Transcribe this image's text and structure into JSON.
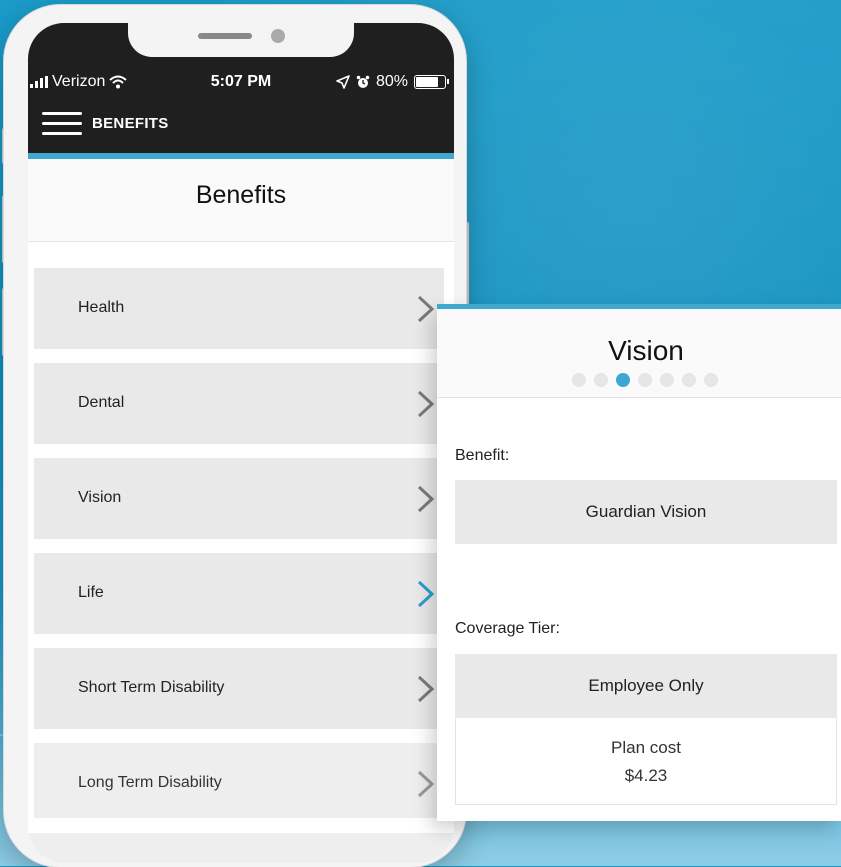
{
  "status_bar": {
    "carrier": "Verizon",
    "time": "5:07 PM",
    "battery": "80%",
    "battery_level": 0.8,
    "icons": [
      "signal-icon",
      "wifi-icon",
      "location-arrow-icon",
      "alarm-icon",
      "battery-icon"
    ]
  },
  "nav": {
    "menu_icon": "hamburger-menu-icon",
    "title": "BENEFITS"
  },
  "page": {
    "title": "Benefits"
  },
  "benefits_list": {
    "items": [
      {
        "label": "Health",
        "chevron_color": "#7a7a7a"
      },
      {
        "label": "Dental",
        "chevron_color": "#7a7a7a"
      },
      {
        "label": "Vision",
        "chevron_color": "#7a7a7a"
      },
      {
        "label": "Life",
        "chevron_color": "#2d9dc9"
      },
      {
        "label": "Short Term Disability",
        "chevron_color": "#7a7a7a"
      },
      {
        "label": "Long Term Disability",
        "chevron_color": "#9a9a9a"
      }
    ]
  },
  "vision_card": {
    "title": "Vision",
    "pager": {
      "total": 7,
      "active_index": 2
    },
    "benefit_label": "Benefit:",
    "benefit_value": "Guardian Vision",
    "coverage_label": "Coverage Tier:",
    "coverage_value": "Employee Only",
    "plan_cost_label": "Plan cost",
    "plan_cost_value": "$4.23"
  },
  "colors": {
    "accent": "#41a9cf",
    "active_dot": "#3ba7d2",
    "background": "#1a9bc8",
    "dark_bar": "#1f1f1f"
  }
}
